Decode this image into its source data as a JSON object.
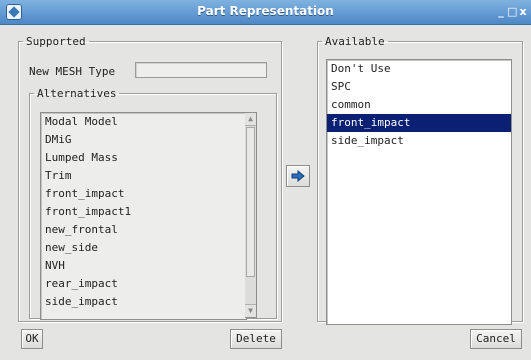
{
  "window": {
    "title": "Part Representation",
    "controls": [
      "_",
      "□",
      "x"
    ]
  },
  "supported": {
    "legend": "Supported",
    "new_mesh_type_label": "New MESH Type",
    "new_mesh_type_value": "",
    "alternatives": {
      "legend": "Alternatives",
      "items": [
        "Modal Model",
        "DMiG",
        "Lumped Mass",
        "Trim",
        "front_impact",
        "front_impact1",
        "new_frontal",
        "new_side",
        "NVH",
        "rear_impact",
        "side_impact"
      ]
    }
  },
  "available": {
    "legend": "Available",
    "items": [
      "Don't Use",
      "SPC",
      "common",
      "front_impact",
      "side_impact"
    ],
    "selected_index": 3
  },
  "buttons": {
    "ok": "OK",
    "delete": "Delete",
    "cancel": "Cancel"
  },
  "colors": {
    "titlebar": "#4d87c6",
    "selection": "#0b1f73",
    "arrow": "#2a6fbf"
  }
}
